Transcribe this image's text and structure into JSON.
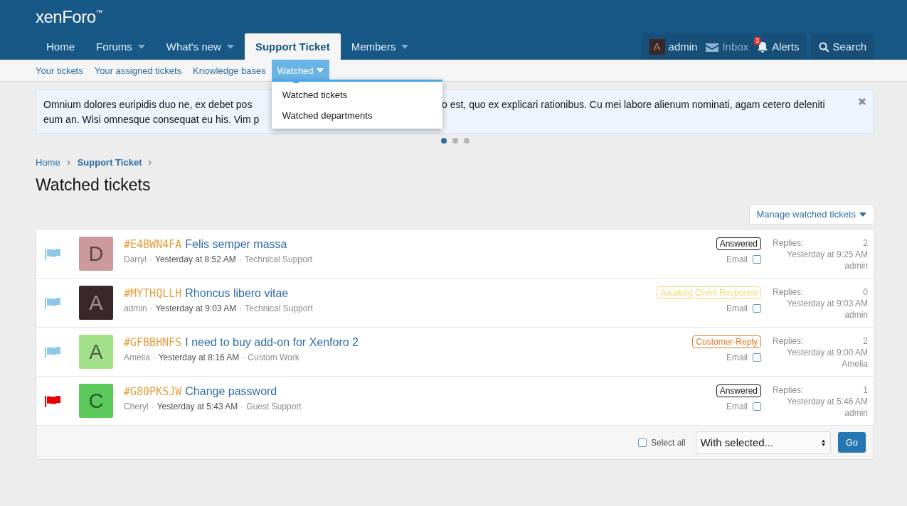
{
  "logo": {
    "prefix": "xen",
    "suffix": "Foro",
    "mark": "™"
  },
  "nav": {
    "tabs": [
      {
        "label": "Home",
        "selected": false,
        "has_menu": false
      },
      {
        "label": "Forums",
        "selected": false,
        "has_menu": true
      },
      {
        "label": "What's new",
        "selected": false,
        "has_menu": true
      },
      {
        "label": "Support Ticket",
        "selected": true,
        "has_menu": false
      },
      {
        "label": "Members",
        "selected": false,
        "has_menu": true
      }
    ],
    "account": {
      "avatar_letter": "A",
      "username": "admin",
      "inbox": "Inbox",
      "alerts": "Alerts",
      "alerts_badge": "3",
      "search": "Search"
    }
  },
  "subnav": {
    "items": [
      {
        "label": "Your tickets",
        "selected": false,
        "has_menu": false
      },
      {
        "label": "Your assigned tickets",
        "selected": false,
        "has_menu": false
      },
      {
        "label": "Knowledge bases",
        "selected": false,
        "has_menu": false
      },
      {
        "label": "Watched",
        "selected": true,
        "has_menu": true
      }
    ],
    "menu": [
      "Watched tickets",
      "Watched departments"
    ]
  },
  "notice": {
    "lines": [
      {
        "left": "Omnium dolores euripidis duo ne, ex debet pos",
        "right": "o est, quo ex explicari rationibus. Cu mei labore alienum nominati, agam cetero deleniti"
      },
      {
        "left": "eum an. Wisi omnesque consequat eu his. Vim p"
      }
    ],
    "dots": [
      {
        "selected": true
      },
      {
        "selected": false
      },
      {
        "selected": false
      }
    ]
  },
  "breadcrumb": [
    {
      "label": "Home",
      "current": false
    },
    {
      "label": "Support Ticket",
      "current": true
    }
  ],
  "page_title": "Watched tickets",
  "manage_button": "Manage watched tickets",
  "tickets": [
    {
      "flag": {
        "color": "#8ec9e8"
      },
      "avatar": {
        "letter": "D",
        "color": "#cc9a9a"
      },
      "code": "#E4BWN4FA",
      "title": "Felis semper massa",
      "meta": [
        {
          "kind": "author",
          "text": "Darryl"
        },
        {
          "kind": "separator",
          "text": "·"
        },
        {
          "kind": "time",
          "text": "Yesterday at 8:52 AM"
        },
        {
          "kind": "separator",
          "text": "·"
        },
        {
          "kind": "department",
          "text": "Technical Support"
        }
      ],
      "status": {
        "label": "Answered",
        "color": "#141414"
      },
      "email_label": "Email",
      "email_checked": false,
      "replies_label": "Replies:",
      "replies": "2",
      "last_time": "Yesterday at 9:25 AM",
      "last_user": "admin"
    },
    {
      "flag": {
        "color": "#8ec9e8"
      },
      "avatar": {
        "letter": "A",
        "color": "#3a2828"
      },
      "code": "#MYTHQLLH",
      "title": "Rhoncus libero vitae",
      "meta": [
        {
          "kind": "author",
          "text": "admin"
        },
        {
          "kind": "separator",
          "text": "·"
        },
        {
          "kind": "time",
          "text": "Yesterday at 9:03 AM"
        },
        {
          "kind": "separator",
          "text": "·"
        },
        {
          "kind": "department",
          "text": "Technical Support"
        }
      ],
      "status": {
        "label": "Awaiting Client Response",
        "color": "#f5d76e"
      },
      "email_label": "Email",
      "email_checked": false,
      "replies_label": "Replies:",
      "replies": "0",
      "last_time": "Yesterday at 9:03 AM",
      "last_user": "admin"
    },
    {
      "flag": {
        "color": "#8ec9e8"
      },
      "avatar": {
        "letter": "A",
        "color": "#a3e08a"
      },
      "code": "#GFBBHNFS",
      "title": "I need to buy add-on for Xenforo 2",
      "meta": [
        {
          "kind": "author",
          "text": "Amelia"
        },
        {
          "kind": "separator",
          "text": "·"
        },
        {
          "kind": "time",
          "text": "Yesterday at 8:16 AM"
        },
        {
          "kind": "separator",
          "text": "·"
        },
        {
          "kind": "department",
          "text": "Custom Work"
        }
      ],
      "status": {
        "label": "Customer-Reply",
        "color": "#e07b24"
      },
      "email_label": "Email",
      "email_checked": false,
      "replies_label": "Replies:",
      "replies": "2",
      "last_time": "Yesterday at 9:00 AM",
      "last_user": "Amelia"
    },
    {
      "flag": {
        "color": "#e60000"
      },
      "avatar": {
        "letter": "C",
        "color": "#5cc95c"
      },
      "code": "#G80PKSJW",
      "title": "Change password",
      "meta": [
        {
          "kind": "author",
          "text": "Cheryl"
        },
        {
          "kind": "separator",
          "text": "·"
        },
        {
          "kind": "time",
          "text": "Yesterday at 5:43 AM"
        },
        {
          "kind": "separator",
          "text": "·"
        },
        {
          "kind": "department",
          "text": "Guest Support"
        }
      ],
      "status": {
        "label": "Answered",
        "color": "#141414"
      },
      "email_label": "Email",
      "email_checked": false,
      "replies_label": "Replies:",
      "replies": "1",
      "last_time": "Yesterday at 5:46 AM",
      "last_user": "admin"
    }
  ],
  "footer": {
    "select_all": "Select all",
    "select_all_checked": false,
    "action_select": "With selected...",
    "go": "Go"
  }
}
